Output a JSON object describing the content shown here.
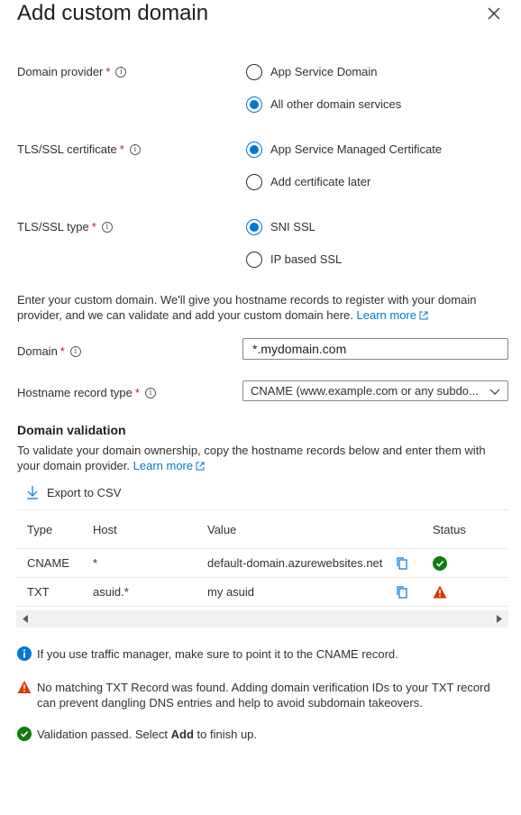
{
  "header": {
    "title": "Add custom domain",
    "close_icon": "close-icon"
  },
  "form": {
    "domain_provider": {
      "label": "Domain provider",
      "required": "*",
      "info": "i",
      "options": [
        "App Service Domain",
        "All other domain services"
      ],
      "selected": "All other domain services"
    },
    "tls_certificate": {
      "label": "TLS/SSL certificate",
      "required": "*",
      "info": "i",
      "options": [
        "App Service Managed Certificate",
        "Add certificate later"
      ],
      "selected": "App Service Managed Certificate"
    },
    "tls_type": {
      "label": "TLS/SSL type",
      "required": "*",
      "info": "i",
      "options": [
        "SNI SSL",
        "IP based SSL"
      ],
      "selected": "SNI SSL"
    },
    "intro": {
      "text": "Enter your custom domain. We'll give you hostname records to register with your domain provider, and we can validate and add your custom domain here. ",
      "link": "Learn more"
    },
    "domain": {
      "label": "Domain",
      "required": "*",
      "info": "i",
      "value": "*.mydomain.com"
    },
    "record_type": {
      "label": "Hostname record type",
      "required": "*",
      "info": "i",
      "value": "CNAME (www.example.com or any subdo..."
    }
  },
  "validation": {
    "heading": "Domain validation",
    "text": "To validate your domain ownership, copy the hostname records below and enter them with your domain provider. ",
    "link": "Learn more",
    "export_label": "Export to CSV",
    "columns": [
      "Type",
      "Host",
      "Value",
      "Status"
    ],
    "rows": [
      {
        "type": "CNAME",
        "host": "*",
        "value": "default-domain.azurewebsites.net",
        "status": "success"
      },
      {
        "type": "TXT",
        "host": "asuid.*",
        "value": "my asuid",
        "status": "warning"
      }
    ]
  },
  "messages": {
    "info": "If you use traffic manager, make sure to point it to the CNAME record.",
    "warning": "No matching TXT Record was found. Adding domain verification IDs to your TXT record can prevent dangling DNS entries and help to avoid subdomain takeovers.",
    "success_prefix": "Validation passed. Select ",
    "success_bold": "Add",
    "success_suffix": " to finish up."
  },
  "colors": {
    "accent": "#0078d4",
    "success": "#107c10",
    "warning": "#d83b01",
    "required": "#a4262c"
  }
}
